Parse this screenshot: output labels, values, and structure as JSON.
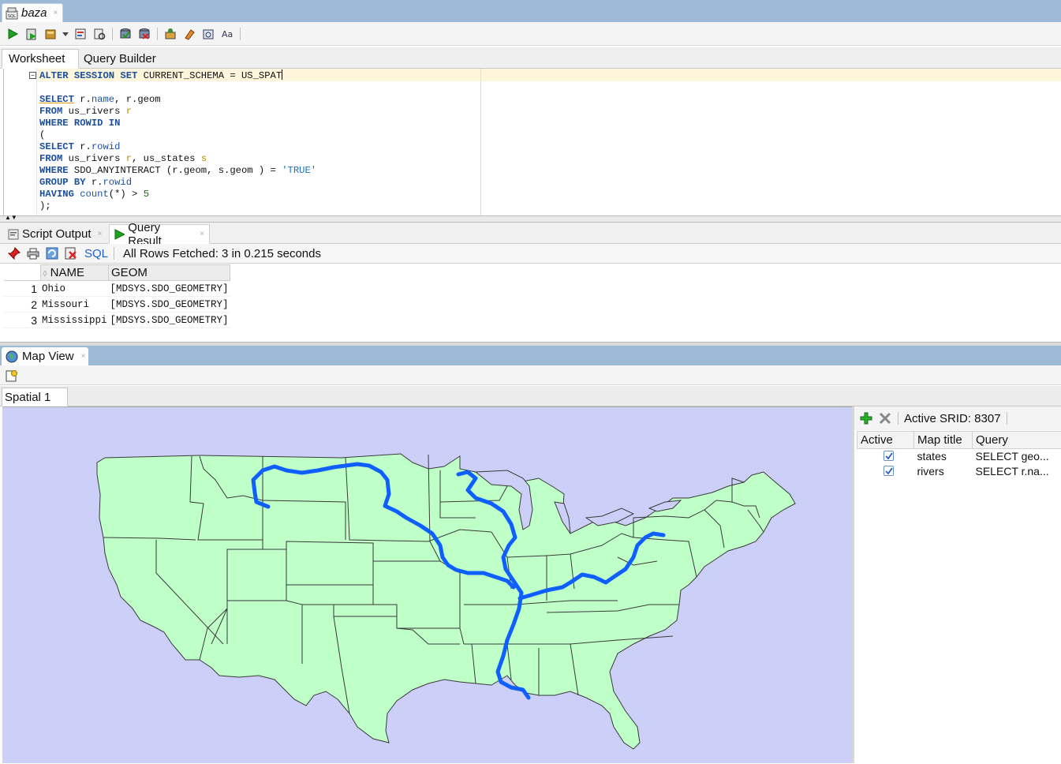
{
  "document_tab": {
    "title": "baza",
    "close": "×"
  },
  "editor_tabs": {
    "worksheet": "Worksheet",
    "query_builder": "Query Builder"
  },
  "toolbar": {
    "icons": [
      "run-statement-icon",
      "run-script-icon",
      "commit-icon",
      "dropdown-icon",
      "autotrace-icon",
      "explain-plan-icon",
      "commit-transaction-icon",
      "rollback-icon",
      "sql-tuning-icon",
      "clear-icon",
      "history-icon",
      "format-icon"
    ]
  },
  "sql": {
    "line1": "ALTER SESSION SET CURRENT_SCHEMA = US_SPAT",
    "lines": [
      "",
      "SELECT r.name, r.geom",
      "FROM us_rivers r",
      "WHERE ROWID IN",
      "(",
      "SELECT r.rowid",
      "FROM us_rivers r, us_states s",
      "WHERE SDO_ANYINTERACT (r.geom, s.geom ) = 'TRUE'",
      "GROUP BY r.rowid",
      "HAVING count(*) > 5",
      ");"
    ]
  },
  "result_tabs": {
    "script_output": "Script Output",
    "query_result": "Query Result",
    "close": "×"
  },
  "result_toolbar": {
    "sql_label": "SQL",
    "status": "All Rows Fetched: 3 in 0.215 seconds"
  },
  "result_grid": {
    "columns": [
      "NAME",
      "GEOM"
    ],
    "rows": [
      {
        "n": "1",
        "name": "Ohio",
        "geom": "[MDSYS.SDO_GEOMETRY]"
      },
      {
        "n": "2",
        "name": "Missouri",
        "geom": "[MDSYS.SDO_GEOMETRY]"
      },
      {
        "n": "3",
        "name": "Mississippi",
        "geom": "[MDSYS.SDO_GEOMETRY]"
      }
    ]
  },
  "map_view": {
    "tab_title": "Map View",
    "close": "×",
    "spatial_tab": "Spatial 1",
    "srid_label": "Active SRID: 8307",
    "layers_columns": [
      "Active",
      "Map title",
      "Query"
    ],
    "layers": [
      {
        "active": true,
        "title": "states",
        "query": "SELECT geo..."
      },
      {
        "active": true,
        "title": "rivers",
        "query": "SELECT r.na..."
      }
    ],
    "colors": {
      "land": "#bfffc8",
      "water": "#cccff8",
      "river": "#0f5fff",
      "border": "#3a3a3a"
    }
  }
}
